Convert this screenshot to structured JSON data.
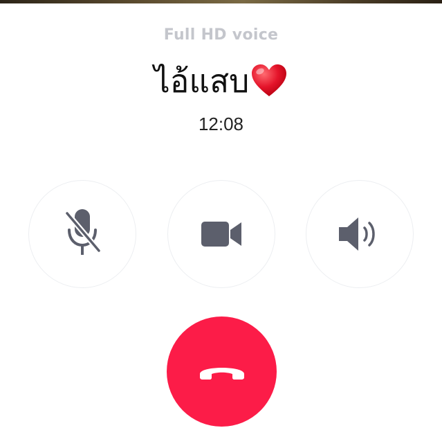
{
  "call": {
    "quality_label": "Full HD voice",
    "caller_name": "ไอ้แสบ",
    "caller_emoji": "heart-icon",
    "duration": "12:08"
  },
  "controls": [
    {
      "name": "mute",
      "icon": "microphone-muted-icon",
      "state": "muted"
    },
    {
      "name": "video",
      "icon": "video-camera-icon"
    },
    {
      "name": "speaker",
      "icon": "speaker-icon"
    }
  ],
  "end_call": {
    "icon": "phone-hangup-icon"
  },
  "colors": {
    "end_call": "#fc1c48",
    "icon": "#5c5f6c",
    "quality_label": "#c4c6cc",
    "heart": "#e4142a",
    "control_border": "#eceef1"
  }
}
